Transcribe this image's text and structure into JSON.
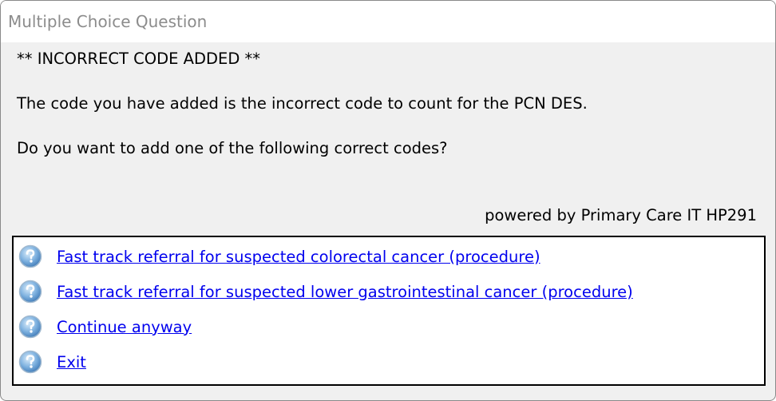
{
  "window": {
    "title": "Multiple Choice Question"
  },
  "message": {
    "heading": "** INCORRECT CODE ADDED **",
    "line1": "The code you have added is the incorrect code to count for the PCN DES.",
    "line2": "Do you want to add one of the following correct codes?",
    "powered_by": "powered by Primary Care IT HP291"
  },
  "options": [
    {
      "label": "Fast track referral for suspected colorectal cancer (procedure)",
      "icon": "question-icon"
    },
    {
      "label": "Fast track referral for suspected lower gastrointestinal cancer (procedure)",
      "icon": "question-icon"
    },
    {
      "label": "Continue anyway",
      "icon": "question-icon"
    },
    {
      "label": "Exit",
      "icon": "question-icon"
    }
  ],
  "colors": {
    "link": "#0000ee",
    "icon": "#4a8cc9",
    "window_bg": "#f0f0f0"
  }
}
